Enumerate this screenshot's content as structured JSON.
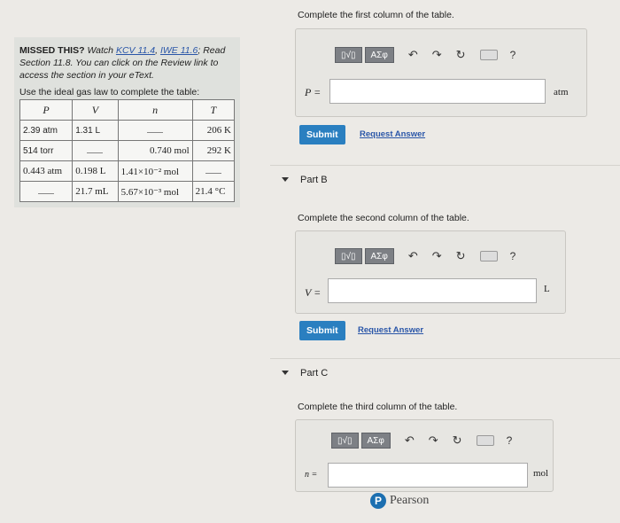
{
  "left": {
    "missed_label": "MISSED THIS?",
    "watch_text": "Watch",
    "kcv_link": "KCV 11.4",
    "iwe_link": "IWE 11.6",
    "read_text": "; Read Section 11.8. You can click on the Review link to access the section in your eText.",
    "use_law": "Use the ideal gas law to complete the table:",
    "table": {
      "headers": [
        "P",
        "V",
        "n",
        "T"
      ],
      "rows": [
        [
          "2.39 atm",
          "1.31 L",
          "",
          "206 K"
        ],
        [
          "514 torr",
          "",
          "0.740 mol",
          "292 K"
        ],
        [
          "0.443 atm",
          "0.198 L",
          "1.41×10⁻² mol",
          ""
        ],
        [
          "",
          "21.7 mL",
          "5.67×10⁻³ mol",
          "21.4 °C"
        ]
      ]
    }
  },
  "parts": {
    "a": {
      "prompt": "Complete the first column of the table.",
      "var_label": "P =",
      "unit": "atm",
      "submit": "Submit",
      "request": "Request Answer"
    },
    "b": {
      "title": "Part B",
      "prompt": "Complete the second column of the table.",
      "var_label": "V =",
      "unit": "L",
      "submit": "Submit",
      "request": "Request Answer"
    },
    "c": {
      "title": "Part C",
      "prompt": "Complete the third column of the table.",
      "var_label": "n =",
      "unit": "mol"
    }
  },
  "toolbar": {
    "template_btn": "▯√▯",
    "greek_btn": "ΑΣφ",
    "undo": "↶",
    "redo": "↷",
    "reset": "↻",
    "help": "?"
  },
  "footer": {
    "brand": "Pearson",
    "logo_letter": "P"
  }
}
